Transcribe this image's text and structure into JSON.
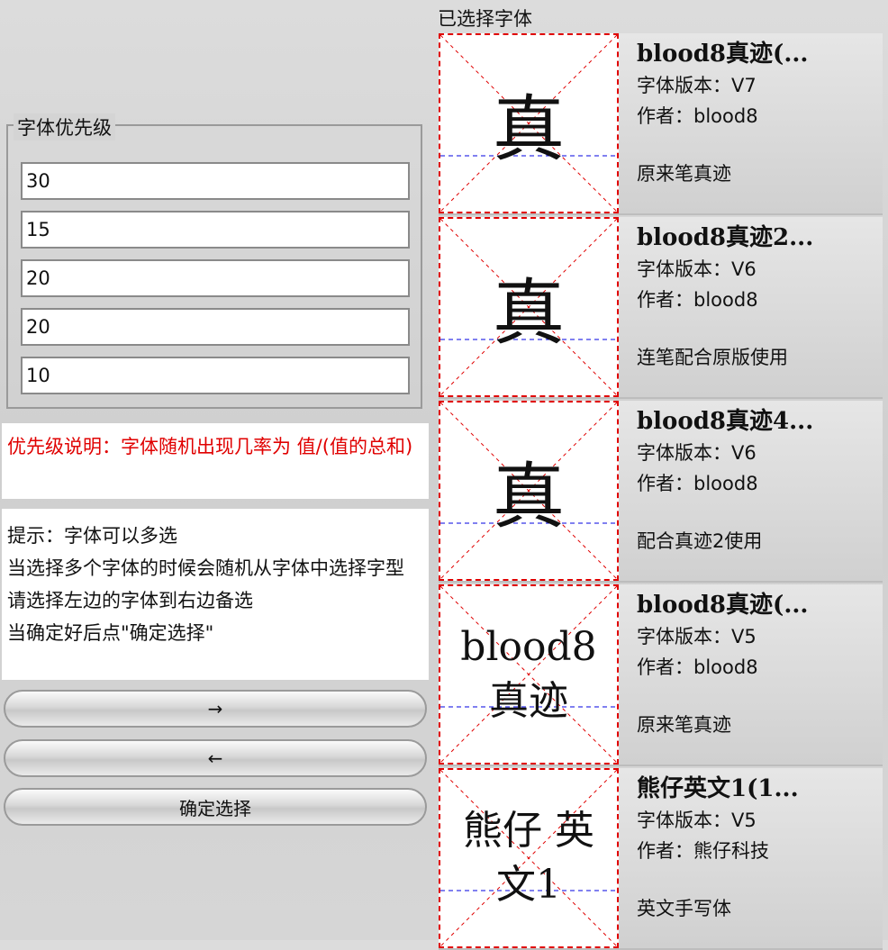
{
  "priority": {
    "legend": "字体优先级",
    "values": [
      "30",
      "15",
      "20",
      "20",
      "10"
    ]
  },
  "priority_note": "优先级说明：字体随机出现几率为 值/(值的总和)",
  "tips": {
    "line1": "提示：字体可以多选",
    "line2": "当选择多个字体的时候会随机从字体中选择字型",
    "line3": "请选择左边的字体到右边备选",
    "line4": "当确定好后点\"确定选择\""
  },
  "buttons": {
    "add": "→",
    "remove": "←",
    "confirm": "确定选择"
  },
  "selected": {
    "title": "已选择字体",
    "fonts": [
      {
        "name": "blood8真迹(...",
        "version": "字体版本：V7",
        "author": "作者：blood8",
        "desc": "原来笔真迹",
        "glyph": "真"
      },
      {
        "name": "blood8真迹2...",
        "version": "字体版本：V6",
        "author": "作者：blood8",
        "desc": "连笔配合原版使用",
        "glyph": "真"
      },
      {
        "name": "blood8真迹4...",
        "version": "字体版本：V6",
        "author": "作者：blood8",
        "desc": "配合真迹2使用",
        "glyph": "真"
      },
      {
        "name": "blood8真迹(...",
        "version": "字体版本：V5",
        "author": "作者：blood8",
        "desc": "原来笔真迹",
        "glyph": "blood8 真迹"
      },
      {
        "name": "熊仔英文1(1...",
        "version": "字体版本：V5",
        "author": "作者：熊仔科技",
        "desc": "英文手写体",
        "glyph": "熊仔 英文1"
      }
    ]
  }
}
